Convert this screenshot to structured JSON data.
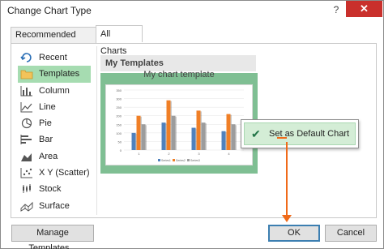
{
  "window": {
    "title": "Change Chart Type",
    "help_label": "?",
    "close_label": "✕"
  },
  "tabs": [
    {
      "label": "Recommended Charts"
    },
    {
      "label": "All Charts"
    }
  ],
  "nav": {
    "selected": "Templates",
    "items": [
      {
        "label": "Recent",
        "icon": "recent-icon"
      },
      {
        "label": "Templates",
        "icon": "folder-icon"
      },
      {
        "label": "Column",
        "icon": "column-chart-icon"
      },
      {
        "label": "Line",
        "icon": "line-chart-icon"
      },
      {
        "label": "Pie",
        "icon": "pie-chart-icon"
      },
      {
        "label": "Bar",
        "icon": "bar-chart-icon"
      },
      {
        "label": "Area",
        "icon": "area-chart-icon"
      },
      {
        "label": "X Y (Scatter)",
        "icon": "scatter-chart-icon"
      },
      {
        "label": "Stock",
        "icon": "stock-chart-icon"
      },
      {
        "label": "Surface",
        "icon": "surface-chart-icon"
      }
    ]
  },
  "templates_section": {
    "header": "My Templates",
    "template_name": "My chart template",
    "preview": {
      "y_ticks": [
        "350",
        "300",
        "250",
        "200",
        "150",
        "100",
        "50",
        "0"
      ],
      "x_ticks": [
        "1",
        "2",
        "3",
        "4"
      ],
      "legend": [
        "Series1",
        "Series2",
        "Series3"
      ],
      "series": [
        {
          "name": "Series1",
          "values": [
            100,
            160,
            130,
            110
          ]
        },
        {
          "name": "Series2",
          "values": [
            200,
            290,
            230,
            210
          ]
        },
        {
          "name": "Series3",
          "values": [
            150,
            200,
            160,
            150
          ]
        }
      ],
      "colors": [
        "#4f81bd",
        "#f07f26",
        "#9c9c9c"
      ]
    }
  },
  "context_menu": {
    "item": "Set as Default Chart",
    "check_icon": "checkmark-icon"
  },
  "buttons": {
    "manage": "Manage Templates...",
    "ok": "OK",
    "cancel": "Cancel"
  },
  "colors": {
    "accent": "#a6dcb1",
    "arrow": "#f06a19",
    "close": "#c9302c"
  }
}
